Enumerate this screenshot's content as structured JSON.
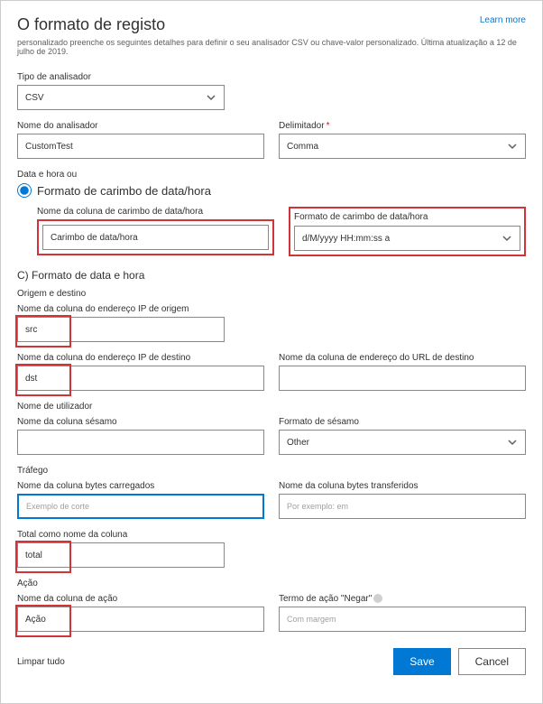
{
  "header": {
    "title": "O formato de registo",
    "subtitle": "personalizado preenche os seguintes detalhes para definir o seu analisador CSV ou chave-valor personalizado. Última atualização a 12 de julho de 2019.",
    "learn_more": "Learn more"
  },
  "parser_type": {
    "label": "Tipo de analisador",
    "value": "CSV"
  },
  "parser_name": {
    "label": "Nome do analisador",
    "value": "CustomTest"
  },
  "delimiter": {
    "label": "Delimitador",
    "value": "Comma"
  },
  "datetime_or": "Data e hora ou",
  "timestamp_format_radio": "Formato de carimbo de data/hora",
  "timestamp_col": {
    "label": "Nome da coluna de carimbo de data/hora",
    "value": "Carimbo de data/hora"
  },
  "timestamp_fmt": {
    "label": "Formato de carimbo de data/hora",
    "value": "d/M/yyyy HH:mm:ss a"
  },
  "section_c": "C) Formato de data e hora",
  "origin_dest": "Origem e destino",
  "src_ip": {
    "label": "Nome da coluna do endereço IP de origem",
    "value": "src"
  },
  "dst_ip": {
    "label": "Nome da coluna do endereço IP de destino",
    "value": "dst"
  },
  "dst_url": {
    "label": "Nome da coluna de endereço do URL de destino",
    "value": ""
  },
  "username_section": "Nome de utilizador",
  "sesame_col": {
    "label": "Nome da coluna sésamo",
    "value": ""
  },
  "sesame_fmt": {
    "label": "Formato de sésamo",
    "value": "Other"
  },
  "traffic_section": "Tráfego",
  "bytes_up": {
    "label": "Nome da coluna bytes carregados",
    "placeholder": "Exemplo de corte"
  },
  "bytes_down": {
    "label": "Nome da coluna bytes transferidos",
    "placeholder": "Por exemplo: em"
  },
  "total_col": {
    "label": "Total como nome da coluna",
    "value": "total"
  },
  "action_section": "Ação",
  "action_col": {
    "label": "Nome da coluna de ação",
    "value": "Ação"
  },
  "negate_term": {
    "label": "Termo de ação \"Negar\"",
    "placeholder": "Com margem"
  },
  "footer": {
    "clear": "Limpar tudo",
    "save": "Save",
    "cancel": "Cancel"
  }
}
